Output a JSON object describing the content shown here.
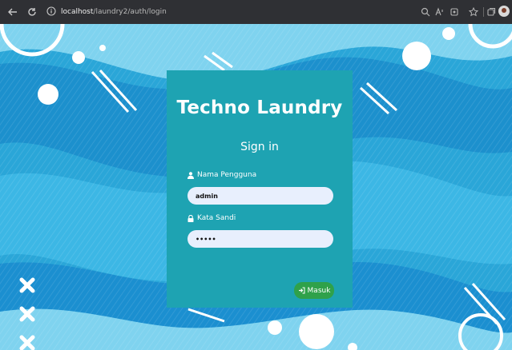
{
  "browser": {
    "url_host": "localhost",
    "url_path": "/laundry2/auth/login",
    "back_icon": "arrow-left-icon",
    "reload_icon": "reload-icon"
  },
  "card": {
    "brand": "Techno Laundry",
    "heading": "Sign in",
    "username_label": "Nama Pengguna",
    "username_value": "admin",
    "password_label": "Kata Sandi",
    "password_value": "admin",
    "submit_label": "Masuk"
  },
  "colors": {
    "card_bg": "#1ea3b2",
    "button_bg": "#2fa14a",
    "input_bg": "#e8effd",
    "page_bg": "#29a8dc"
  }
}
